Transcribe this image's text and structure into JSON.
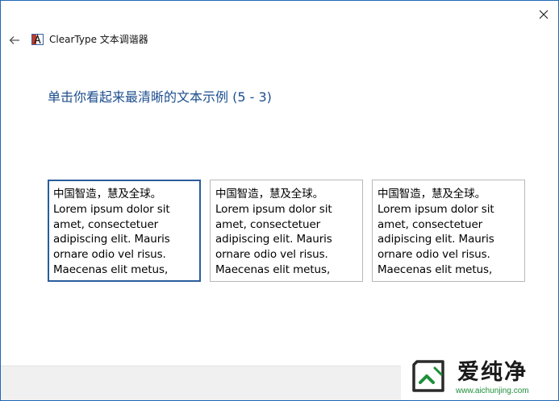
{
  "window": {
    "app_title": "ClearType 文本调谐器",
    "accent_color": "#1f67b8"
  },
  "instruction": "单击你看起来最清晰的文本示例 (5 - 3)",
  "samples": [
    {
      "selected": true,
      "lines": [
        "中国智造，慧及全球。",
        "Lorem ipsum dolor sit",
        "amet, consectetuer",
        "adipiscing elit. Mauris",
        "ornare odio vel risus.",
        "Maecenas elit metus,"
      ]
    },
    {
      "selected": false,
      "lines": [
        "中国智造，慧及全球。",
        "Lorem ipsum dolor sit",
        "amet, consectetuer",
        "adipiscing elit. Mauris",
        "ornare odio vel risus.",
        "Maecenas elit metus,"
      ]
    },
    {
      "selected": false,
      "lines": [
        "中国智造，慧及全球。",
        "Lorem ipsum dolor sit",
        "amet, consectetuer",
        "adipiscing elit. Mauris",
        "ornare odio vel risus.",
        "Maecenas elit metus,"
      ]
    }
  ],
  "icons": {
    "close": "close-icon",
    "back": "back-arrow-icon",
    "app": "cleartype-app-icon"
  },
  "watermark": {
    "brand": "爱纯净",
    "url": "www.aichunjing.com",
    "color": "#1d8f3a"
  }
}
